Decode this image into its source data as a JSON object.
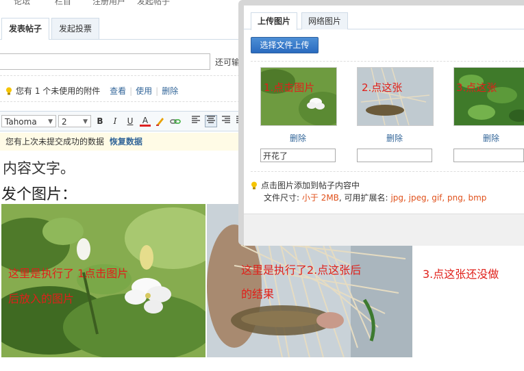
{
  "breadcrumb": {
    "items": [
      "论坛",
      "栏目",
      "注册用户",
      "发起帖子"
    ]
  },
  "editor_tabs": [
    {
      "label": "发表帖子"
    },
    {
      "label": "发起投票"
    }
  ],
  "subject": {
    "value": "",
    "hint": "还可输入"
  },
  "attachment": {
    "text": "您有 1 个未使用的附件",
    "view": "查看",
    "use": "使用",
    "delete": "删除"
  },
  "toolbar": {
    "font": "Tahoma",
    "size": "2",
    "bold": "B",
    "italic": "I",
    "underline": "U",
    "forecolor": "A"
  },
  "restore": {
    "text": "您有上次未提交成功的数据",
    "link": "恢复数据"
  },
  "content": {
    "line1": "内容文字。",
    "line2": "发个图片："
  },
  "annotations": {
    "a1_line1": "这里是执行了 1点击图片",
    "a1_line2": "后放入的图片",
    "a2_line1": "这里是执行了2.点这张后",
    "a2_line2": "的结果",
    "a3": "3.点这张还没做"
  },
  "dialog": {
    "tabs": [
      {
        "label": "上传图片"
      },
      {
        "label": "网络图片"
      }
    ],
    "upload_button": "选择文件上传",
    "thumbs": [
      {
        "overlay": "1.点击图片",
        "delete": "删除",
        "caption": "开花了"
      },
      {
        "overlay": "2.点这张",
        "delete": "删除",
        "caption": ""
      },
      {
        "overlay": "3.点这张",
        "delete": "删除",
        "caption": ""
      }
    ],
    "tip": "点击图片添加到帖子内容中",
    "file_size_label": "文件尺寸:",
    "file_size_value": "小于 2MB",
    "ext_label": ", 可用扩展名:",
    "ext_value": "jpg, jpeg, gif, png, bmp"
  },
  "colors": {
    "annotation_red": "#e0201a",
    "link_blue": "#336699",
    "button_blue": "#2a6bbf"
  }
}
